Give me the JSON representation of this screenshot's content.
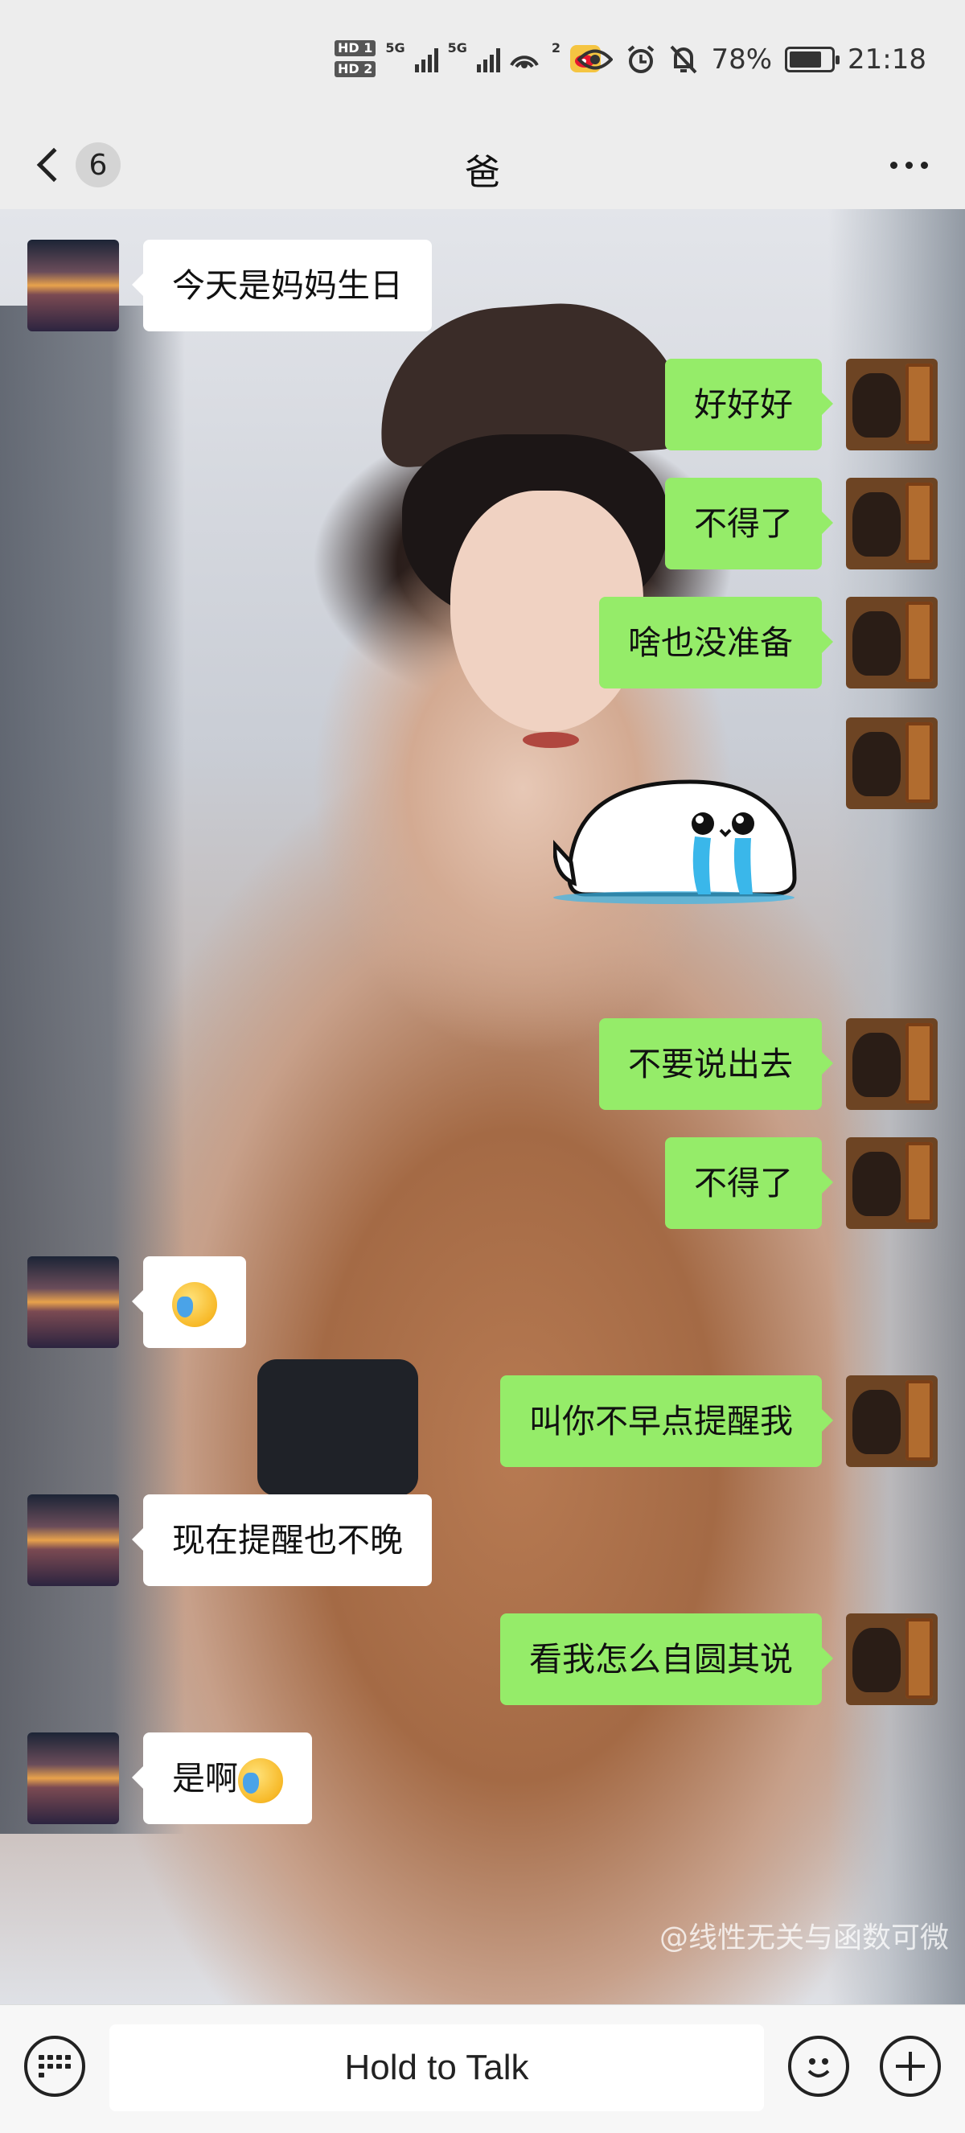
{
  "status_bar": {
    "hd1": "HD 1",
    "hd2": "HD 2",
    "net1": "5G",
    "net2": "5G",
    "hotspot_count": "2",
    "battery": "78%",
    "time": "21:18"
  },
  "header": {
    "unread_count": "6",
    "title": "爸"
  },
  "messages": [
    {
      "side": "left",
      "avatar": "sunset",
      "text": "今天是妈妈生日"
    },
    {
      "side": "right",
      "avatar": "monkey",
      "text": "好好好"
    },
    {
      "side": "right",
      "avatar": "monkey",
      "text": "不得了"
    },
    {
      "side": "right",
      "avatar": "monkey",
      "text": "啥也没准备"
    },
    {
      "side": "right",
      "avatar": "monkey",
      "sticker": "crying-seal-sticker"
    },
    {
      "side": "right",
      "avatar": "monkey",
      "text": "不要说出去"
    },
    {
      "side": "right",
      "avatar": "monkey",
      "text": "不得了"
    },
    {
      "side": "left",
      "avatar": "sunset",
      "emoji": "facepalm-crying-emoji"
    },
    {
      "side": "right",
      "avatar": "monkey",
      "text": "叫你不早点提醒我"
    },
    {
      "side": "left",
      "avatar": "sunset",
      "text": "现在提醒也不晚"
    },
    {
      "side": "right",
      "avatar": "monkey",
      "text": "看我怎么自圆其说"
    },
    {
      "side": "left",
      "avatar": "sunset",
      "text": "是啊",
      "emoji": "facepalm-crying-emoji"
    }
  ],
  "background_watermark": "@线性无关与函数可微",
  "input_bar": {
    "hold_to_talk": "Hold to Talk"
  },
  "icons": [
    "back-chevron-icon",
    "more-icon",
    "keyboard-icon",
    "emoji-icon",
    "plus-icon",
    "eye-icon",
    "alarm-icon",
    "mute-bell-icon",
    "battery-icon",
    "weibo-icon",
    "wifi-hotspot-icon"
  ],
  "colors": {
    "bubble_self": "#95ec69",
    "bubble_other": "#ffffff",
    "background": "#ededed"
  }
}
